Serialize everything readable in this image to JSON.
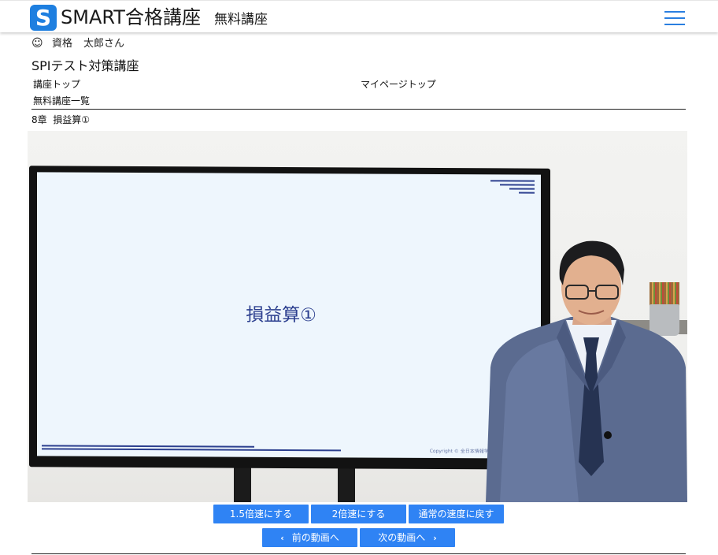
{
  "header": {
    "logo_letter": "S",
    "title": "SMART合格講座",
    "subtitle": "無料講座",
    "accent_color": "#1e7fe0"
  },
  "user": {
    "icon": "smile-icon",
    "label": "資格",
    "name": "太郎さん"
  },
  "course": {
    "title": "SPIテスト対策講座"
  },
  "nav": {
    "course_top": "講座トップ",
    "mypage_top": "マイページトップ",
    "free_list": "無料講座一覧"
  },
  "chapter": {
    "label": "8章",
    "title": "損益算①"
  },
  "video": {
    "slide_title": "損益算①",
    "copyright": "Copyright © 全日本情報学習振興協会 All Rights"
  },
  "controls": {
    "speed_15": "1.5倍速にする",
    "speed_2": "2倍速にする",
    "speed_normal": "通常の速度に戻す",
    "prev": "前の動画へ",
    "next": "次の動画へ",
    "button_color": "#2f83f4"
  }
}
